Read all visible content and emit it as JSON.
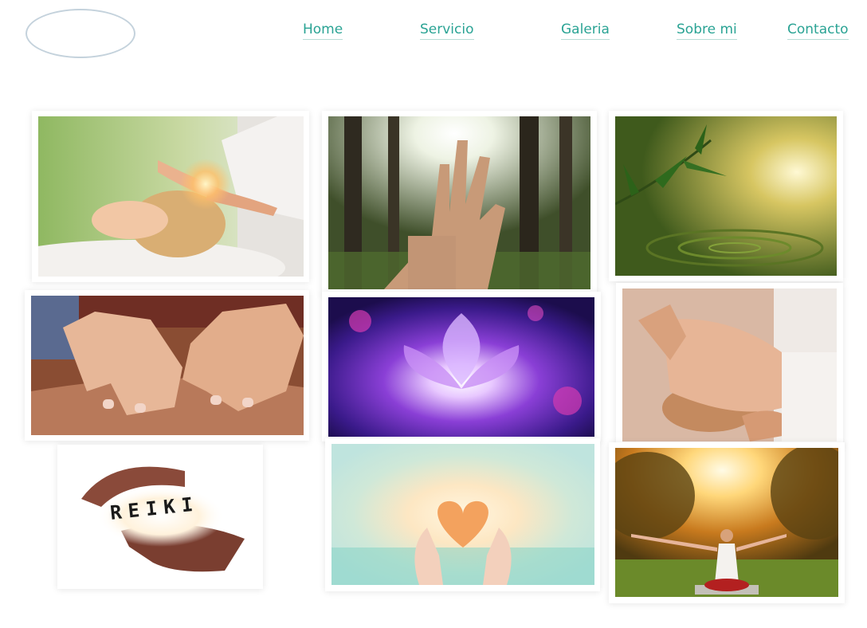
{
  "nav": [
    {
      "label": "Home"
    },
    {
      "label": "Servicio"
    },
    {
      "label": "Galeria"
    },
    {
      "label": "Sobre mi"
    },
    {
      "label": "Contacto"
    }
  ],
  "gallery": {
    "reiki_word": "REIKI"
  },
  "colors": {
    "accent": "#2aa394",
    "logo_outline": "#c4d2dc"
  }
}
